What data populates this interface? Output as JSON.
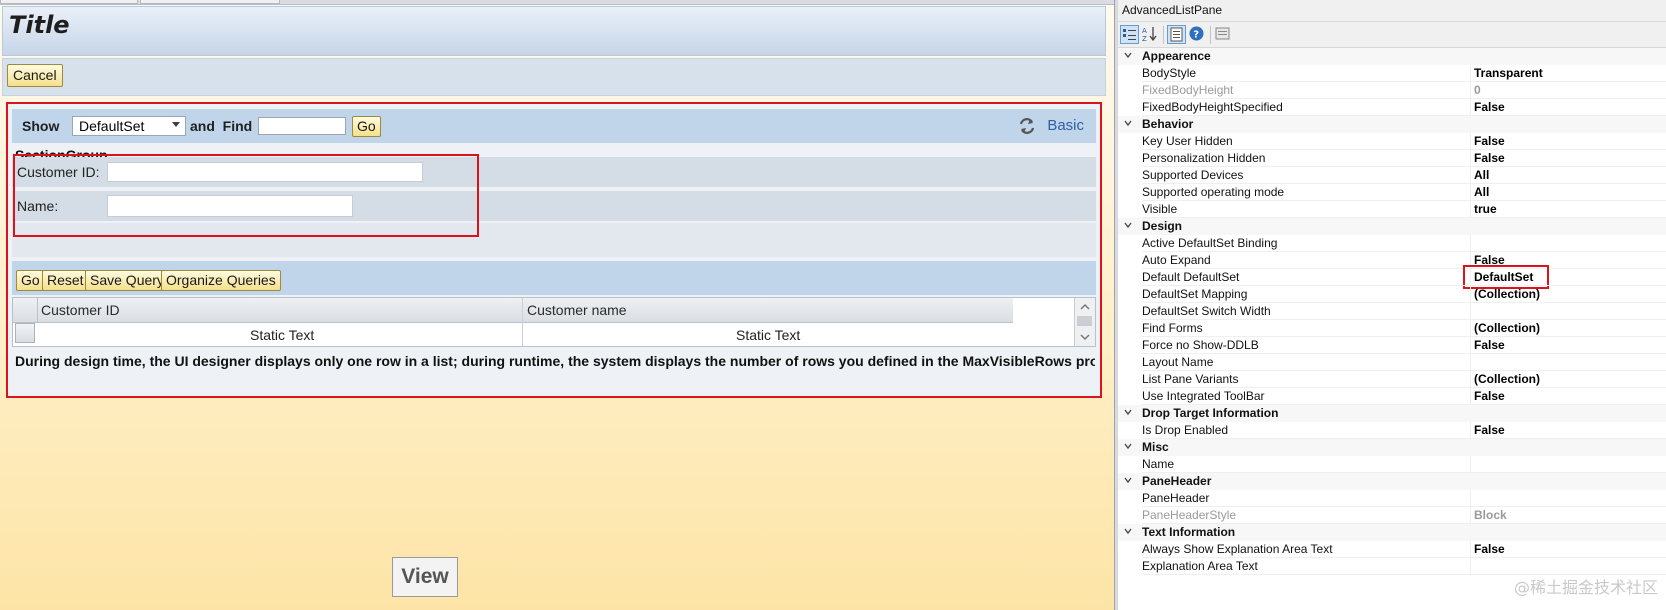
{
  "designer": {
    "title": "Title",
    "cancel_label": "Cancel",
    "filter": {
      "show_label": "Show",
      "selected_set": "DefaultSet",
      "find_label": "and  Find",
      "go_label": "Go",
      "basic_link": "Basic"
    },
    "section_group": {
      "title": "SectionGroup",
      "fields": [
        {
          "label": "Customer ID:"
        },
        {
          "label": "Name:"
        }
      ]
    },
    "toolbar": {
      "go_label": "Go",
      "reset_label": "Reset",
      "save_query_label": "Save Query",
      "organize_queries_label": "Organize Queries"
    },
    "grid": {
      "columns": [
        "Customer ID",
        "Customer name"
      ],
      "rows": [
        [
          "Static Text",
          "Static Text"
        ]
      ]
    },
    "note": "During design time, the UI designer displays only one row in a list; during runtime, the system displays the number of rows you defined in the MaxVisibleRows prop",
    "view_label": "View"
  },
  "properties": {
    "title": "AdvancedListPane",
    "rows": [
      {
        "type": "cat",
        "name": "Appearence"
      },
      {
        "name": "BodyStyle",
        "value": "Transparent"
      },
      {
        "name": "FixedBodyHeight",
        "value": "0",
        "dim": true
      },
      {
        "name": "FixedBodyHeightSpecified",
        "value": "False"
      },
      {
        "type": "cat",
        "name": "Behavior"
      },
      {
        "name": "Key User Hidden",
        "value": "False"
      },
      {
        "name": "Personalization Hidden",
        "value": "False"
      },
      {
        "name": "Supported Devices",
        "value": "All"
      },
      {
        "name": "Supported operating mode",
        "value": "All"
      },
      {
        "name": "Visible",
        "value": "true"
      },
      {
        "type": "cat",
        "name": "Design"
      },
      {
        "name": "Active DefaultSet Binding",
        "value": ""
      },
      {
        "name": "Auto Expand",
        "value": "False"
      },
      {
        "name": "Default DefaultSet",
        "value": "DefaultSet",
        "highlight": true
      },
      {
        "name": "DefaultSet Mapping",
        "value": "(Collection)"
      },
      {
        "name": "DefaultSet Switch Width",
        "value": ""
      },
      {
        "name": "Find Forms",
        "value": "(Collection)"
      },
      {
        "name": "Force no Show-DDLB",
        "value": "False"
      },
      {
        "name": "Layout Name",
        "value": ""
      },
      {
        "name": "List Pane Variants",
        "value": "(Collection)"
      },
      {
        "name": "Use Integrated ToolBar",
        "value": "False"
      },
      {
        "type": "cat",
        "name": "Drop Target Information"
      },
      {
        "name": "Is Drop Enabled",
        "value": "False"
      },
      {
        "type": "cat",
        "name": "Misc"
      },
      {
        "name": "Name",
        "value": ""
      },
      {
        "type": "cat",
        "name": "PaneHeader"
      },
      {
        "name": "PaneHeader",
        "value": ""
      },
      {
        "name": "PaneHeaderStyle",
        "value": "Block",
        "dim": true
      },
      {
        "type": "cat",
        "name": "Text Information"
      },
      {
        "name": "Always Show Explanation Area Text",
        "value": "False"
      },
      {
        "name": "Explanation Area Text",
        "value": ""
      }
    ],
    "toolbar_icons": [
      "categorized-icon",
      "alphabetical-icon",
      "properties-icon",
      "events-icon",
      "property-pages-icon"
    ]
  },
  "watermark": "@稀土掘金技术社区",
  "colors": {
    "highlight_border": "#d9141b",
    "button_fill": "#f4e08c",
    "header_blue": "#c1d5ea",
    "link_blue": "#2d5fa8"
  }
}
